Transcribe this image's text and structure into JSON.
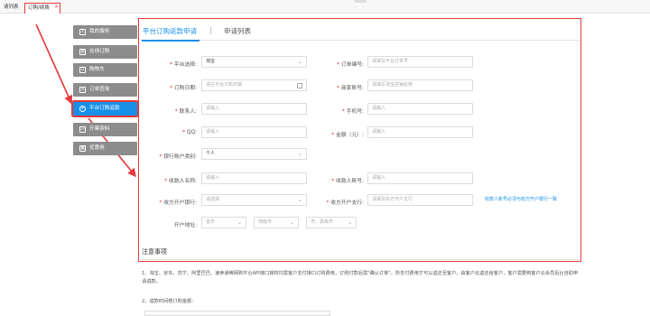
{
  "topbar": {
    "tabs": [
      {
        "label": "请列表"
      },
      {
        "label": "订购/续费",
        "close": "×"
      }
    ]
  },
  "sidebar": {
    "items": [
      {
        "label": "我的服务",
        "icon": "user-icon",
        "glyph": "♙"
      },
      {
        "label": "在线订购",
        "icon": "order-icon",
        "glyph": "▤"
      },
      {
        "label": "购物车",
        "icon": "cart-icon",
        "glyph": "⊔"
      },
      {
        "label": "订单查询",
        "icon": "list-icon",
        "glyph": "≡"
      },
      {
        "label": "平台订购返款",
        "icon": "refund-icon",
        "glyph": "¥",
        "active": true
      },
      {
        "label": "开票资料",
        "icon": "invoice-icon",
        "glyph": "▭"
      },
      {
        "label": "优惠券",
        "icon": "coupon-icon",
        "glyph": "▦"
      }
    ]
  },
  "panel": {
    "tabs": [
      {
        "label": "平台订购返款申请",
        "active": true
      },
      {
        "label": "申请列表"
      }
    ],
    "separator": "|",
    "form": {
      "platform": {
        "label": "平台选择:",
        "value": "淘宝"
      },
      "order_no": {
        "label": "订单编号:",
        "placeholder": "请填写平台订单号"
      },
      "order_date": {
        "label": "订购日期:",
        "placeholder": "请在平台订购日期"
      },
      "merchant_account": {
        "label": "商家账号:",
        "placeholder": "请填写淘宝店铺名称"
      },
      "contact": {
        "label": "联系人:",
        "placeholder": "请输入"
      },
      "mobile": {
        "label": "手机号:",
        "placeholder": "请输入"
      },
      "qq": {
        "label": "QQ:",
        "placeholder": "请输入"
      },
      "amount": {
        "label": "金额（元）:",
        "placeholder": "请输入"
      },
      "account_type": {
        "label": "银行账户类别:",
        "value": "个人"
      },
      "payee_name": {
        "label": "收款人名称:",
        "placeholder": "请输入"
      },
      "payee_account": {
        "label": "收款人账号:",
        "placeholder": "请输入"
      },
      "bank": {
        "label": "收方开户银行:",
        "placeholder": "请选择"
      },
      "branch": {
        "label": "收方开户支行:",
        "placeholder": "请填写收方开户支行"
      },
      "branch_hint": "收款人账号必须与收方开户银行一致",
      "address": {
        "label": "开户地址:",
        "province": "省市",
        "city": "地级市",
        "district": "市、县级市"
      }
    }
  },
  "notice": {
    "title": "注意事项",
    "item1": "1、淘宝、京东、苏宁、阿里巴巴、速卖通等网购平台API接口授权均需客户支付接口订购费用，订购付款后需\"确认订单\"，所支付费用才可以返还至客户，由客户云返还给客户，客户需要到客户云会员后台自助申请返款。",
    "item2": "2、返款时间根订购金额："
  }
}
